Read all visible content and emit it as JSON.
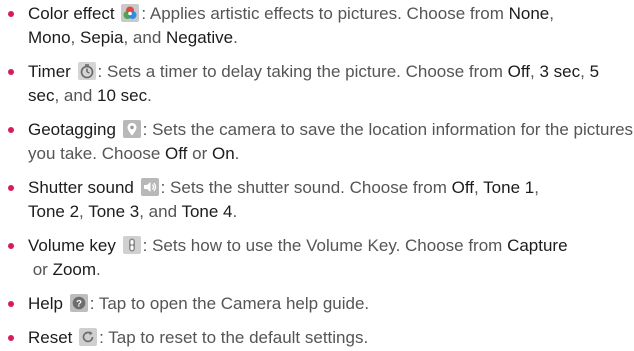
{
  "accent_color": "#d81b60",
  "items": [
    {
      "term": "Color effect",
      "icon": "color-effect-icon",
      "text1": ": Applies artistic effects to pictures. Choose from ",
      "opt1": "None",
      "sep1": ",",
      "opt2": "Mono",
      "sep2": ", ",
      "opt3": "Sepia",
      "sep3": ", and ",
      "opt4": "Negative",
      "end": "."
    },
    {
      "term": "Timer",
      "icon": "timer-icon",
      "text1": ": Sets a timer to delay taking the picture. Choose from ",
      "opt1": "Off",
      "sep1": ", ",
      "opt2": "3 sec",
      "sep2": ", ",
      "opt3": "5 sec",
      "sep3": ", and ",
      "opt4": "10 sec",
      "end": "."
    },
    {
      "term": "Geotagging",
      "icon": "location-pin-icon",
      "text1": ": Sets the camera to save the location information for the pictures you take. Choose ",
      "opt1": "Off",
      "sep1": " or ",
      "opt2": "On",
      "end": "."
    },
    {
      "term": "Shutter sound",
      "icon": "shutter-sound-icon",
      "text1": ": Sets the shutter sound. Choose from ",
      "opt1": "Off",
      "sep1": ", ",
      "opt2": "Tone 1",
      "sep2": ", ",
      "opt3": "Tone 2",
      "sep3": ", ",
      "opt4": "Tone 3",
      "sep4": ", and ",
      "opt5": "Tone 4",
      "end": "."
    },
    {
      "term": "Volume key",
      "icon": "volume-key-icon",
      "text1": ": Sets how to use the Volume Key. Choose from ",
      "opt1": "Capture",
      "sep1": " or ",
      "opt2": "Zoom",
      "end": "."
    },
    {
      "term": "Help",
      "icon": "help-icon",
      "text1": ": Tap to open the Camera help guide."
    },
    {
      "term": "Reset",
      "icon": "reset-icon",
      "text1": ": Tap to reset to the default settings."
    }
  ]
}
